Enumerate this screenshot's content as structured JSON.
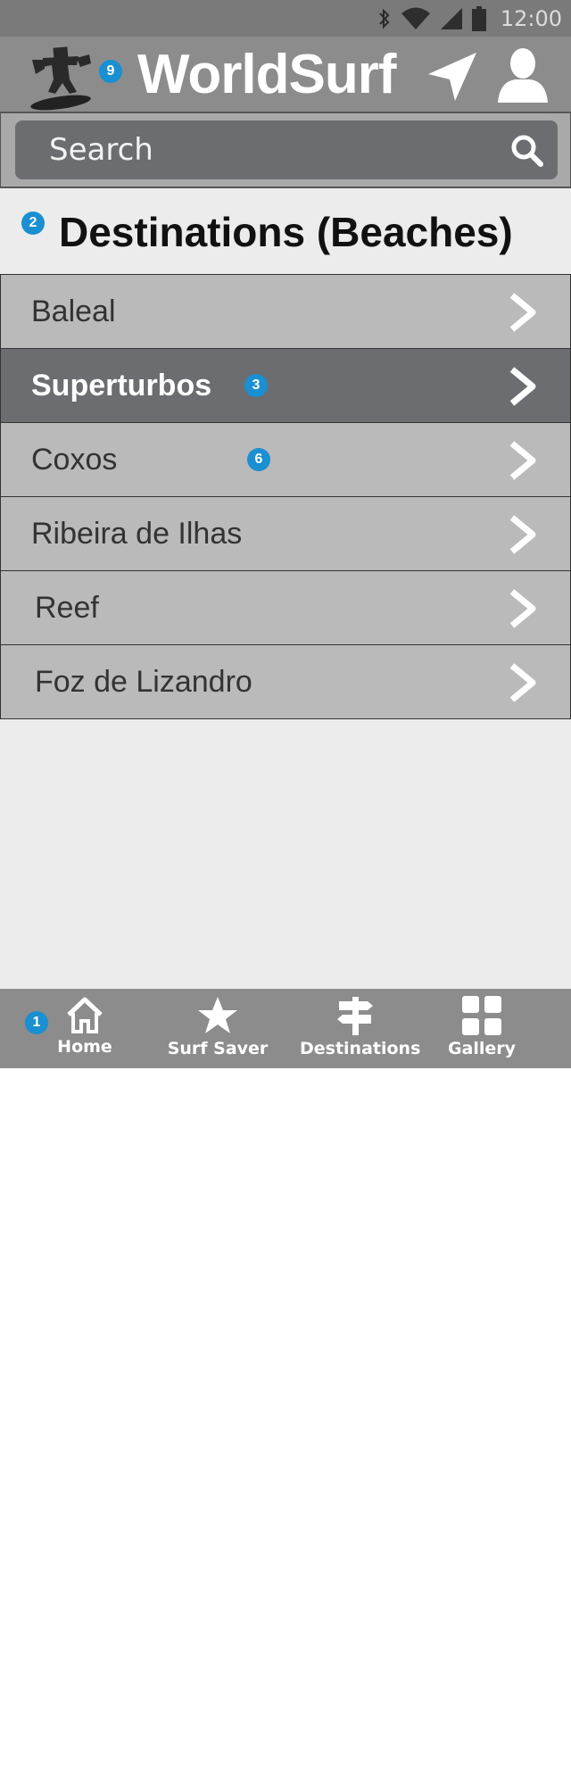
{
  "status_bar": {
    "time": "12:00",
    "icons": [
      "bluetooth-icon",
      "wifi-icon",
      "signal-icon",
      "battery-icon"
    ]
  },
  "app_bar": {
    "title": "WorldSurf",
    "badge": "9",
    "icons": [
      "surfer-logo-icon",
      "navigation-arrow-icon",
      "user-profile-icon"
    ]
  },
  "search": {
    "placeholder": "Search"
  },
  "section": {
    "title": "Destinations (Beaches)",
    "badge": "2"
  },
  "destinations": [
    {
      "label": "Baleal",
      "selected": false
    },
    {
      "label": "Superturbos",
      "selected": true,
      "badge": "3"
    },
    {
      "label": "Coxos",
      "selected": false,
      "badge": "6"
    },
    {
      "label": "Ribeira de Ilhas",
      "selected": false
    },
    {
      "label": "Reef",
      "selected": false
    },
    {
      "label": "Foz de Lizandro",
      "selected": false
    }
  ],
  "bottom_nav": {
    "badge": "1",
    "tabs": [
      {
        "label": "Home",
        "icon": "home-icon"
      },
      {
        "label": "Surf Saver",
        "icon": "star-icon"
      },
      {
        "label": "Destinations",
        "icon": "signpost-icon"
      },
      {
        "label": "Gallery",
        "icon": "grid-icon"
      }
    ]
  },
  "colors": {
    "bar": "#8c8c8c",
    "selected_row": "#6c6d70",
    "row": "#bababa",
    "badge": "#1a8fd1",
    "background": "#ececec"
  }
}
